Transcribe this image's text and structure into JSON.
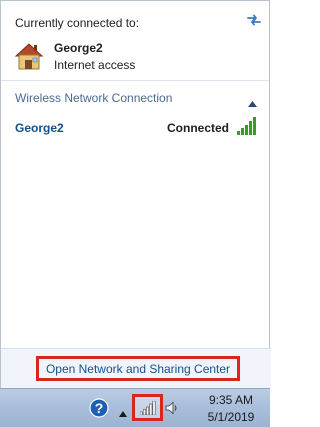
{
  "connection": {
    "title": "Currently connected to:",
    "network_name": "George2",
    "network_status": "Internet access",
    "refresh_icon": "refresh-icon",
    "network_icon": "house-network-icon"
  },
  "wireless_section": {
    "title": "Wireless Network Connection",
    "collapse_icon": "chevron-up-icon"
  },
  "networks": [
    {
      "name": "George2",
      "status": "Connected",
      "signal_icon": "signal-bars-icon",
      "signal_bars": 5
    }
  ],
  "footer": {
    "open_center_label": "Open Network and Sharing Center"
  },
  "taskbar": {
    "time": "9:35 AM",
    "date": "5/1/2019",
    "icons": [
      "help-icon",
      "show-hidden-icons-arrow",
      "network-signal-icon",
      "speaker-icon"
    ]
  },
  "colors": {
    "link_blue": "#15508c",
    "section_title": "#4c6a8c",
    "signal_green": "#3a9a2a",
    "highlight_red": "#d9261c",
    "taskbar": "#a9bfdb"
  }
}
